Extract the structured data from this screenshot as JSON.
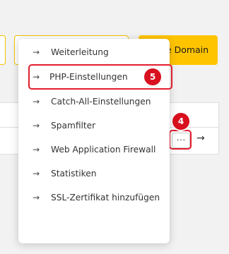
{
  "background": {
    "domain_button_label": "e Domain",
    "row_arrow_icon": "arrow-right-icon",
    "more_button_label": "···"
  },
  "badges": {
    "step_4": "4",
    "step_5": "5"
  },
  "menu": {
    "items": [
      {
        "label": "Weiterleitung"
      },
      {
        "label": "PHP-Einstellungen"
      },
      {
        "label": "Catch-All-Einstellungen"
      },
      {
        "label": "Spamfilter"
      },
      {
        "label": "Web Application Firewall"
      },
      {
        "label": "Statistiken"
      },
      {
        "label": "SSL-Zertifikat hinzufügen"
      }
    ],
    "arrow_glyph": "→"
  },
  "colors": {
    "accent_yellow": "#ffc400",
    "highlight_red": "#e11d2e",
    "badge_red": "#d8101f"
  }
}
